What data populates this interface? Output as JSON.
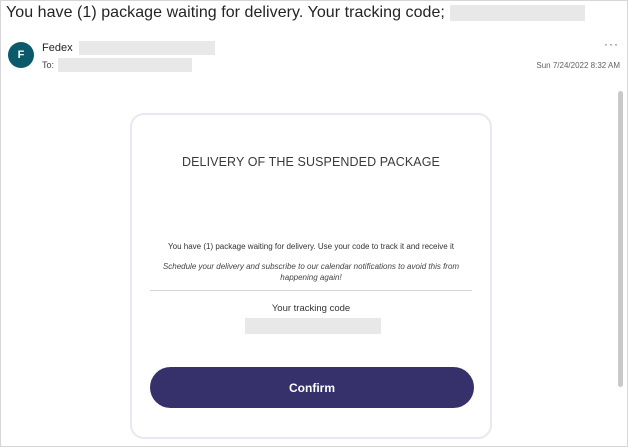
{
  "email": {
    "subject": "You have (1) package waiting for delivery. Your tracking code;",
    "sender": {
      "initial": "F",
      "name": "Fedex"
    },
    "to_label": "To:",
    "date": "Sun 7/24/2022 8:32 AM",
    "more_label": "···"
  },
  "card": {
    "title": "DELIVERY OF THE SUSPENDED PACKAGE",
    "text": "You have (1) package waiting for delivery. Use your code to track it and receive it",
    "italic_note": "Schedule your delivery and subscribe to our calendar notifications to avoid this from happening again!",
    "tracking_label": "Your tracking code",
    "confirm_label": "Confirm"
  },
  "colors": {
    "avatar": "#0b5a6b",
    "button": "#36316a",
    "link": "#2b65b8"
  }
}
